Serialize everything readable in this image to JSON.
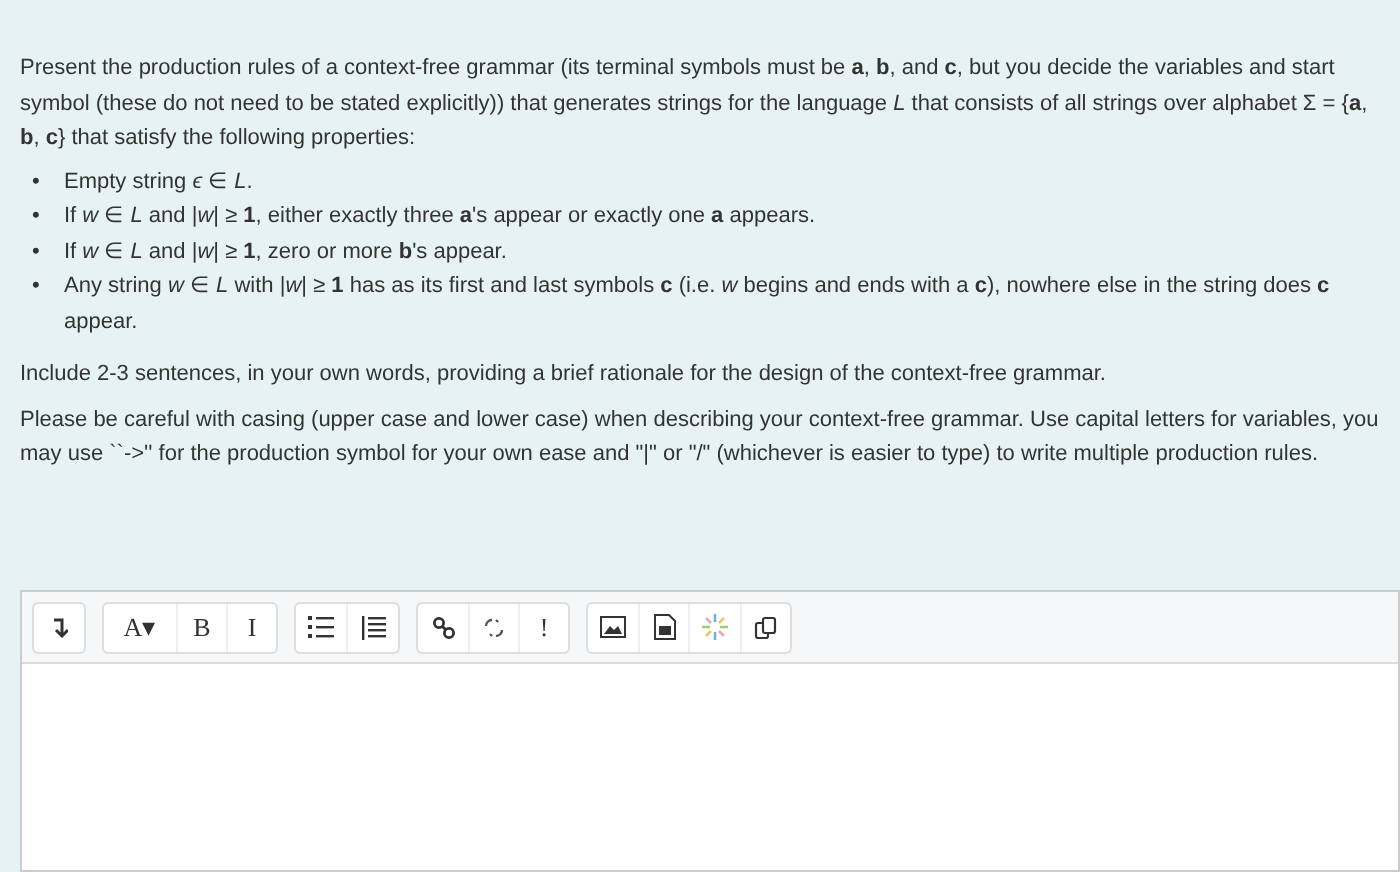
{
  "intro": "Present the production rules of a context-free grammar (its terminal symbols must be **a**, **b**, and **c**, but you decide the variables and start symbol (these do not need to be stated explicitly)) that generates strings for the language *L* that consists of all strings over alphabet Σ = {**a**, **b**, **c**} that satisfy the following properties:",
  "properties": [
    {
      "marker": "•",
      "text": "Empty string *ϵ* ∈ *L*."
    },
    {
      "marker": "•",
      "text": "If *w* ∈ *L* and |*w*| ≥ **1**, either exactly three **a**'s appear or exactly one **a** appears."
    },
    {
      "marker": "•",
      "text": "If *w* ∈ *L* and |*w*| ≥ **1**, zero or more **b**'s appear."
    },
    {
      "marker": "•",
      "text": "Any string *w* ∈ *L* with |*w*| ≥ **1** has as its first and last symbols **c** (i.e. *w* begins and ends with a **c**), nowhere else in the string does **c** appear."
    }
  ],
  "instructions": [
    "Include 2-3 sentences, in your own words, providing a brief rationale for the design of the context-free grammar.",
    "Please be careful with casing (upper case and lower case) when describing your context-free grammar. Use capital letters for variables, you may use ``->'' for the production symbol for your own ease and \"|\" or \"/\" (whichever is easier to type) to write multiple production rules."
  ],
  "editor": {
    "toolbar_groups": [
      [
        {
          "kind": "icon"
        }
      ],
      [
        {
          "kind": "text",
          "label": "A▾"
        },
        {
          "kind": "text",
          "label": "B"
        },
        {
          "kind": "text",
          "label": "I"
        }
      ],
      [
        {
          "kind": "icon"
        },
        {
          "kind": "icon"
        }
      ],
      [
        {
          "kind": "icon"
        },
        {
          "kind": "icon"
        },
        {
          "kind": "text",
          "label": "!"
        }
      ],
      [
        {
          "kind": "icon"
        },
        {
          "kind": "icon"
        },
        {
          "kind": "icon"
        },
        {
          "kind": "icon"
        }
      ]
    ]
  }
}
